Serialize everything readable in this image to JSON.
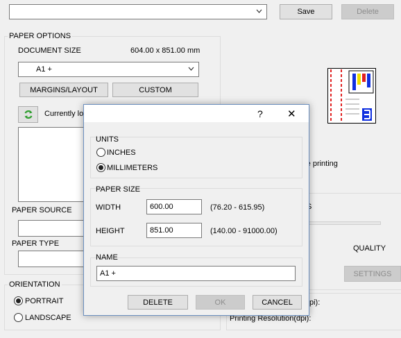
{
  "toolbar": {
    "preset_value": "",
    "save_label": "Save",
    "delete_label": "Delete"
  },
  "paper_options": {
    "legend": "PAPER OPTIONS",
    "document_size_label": "DOCUMENT SIZE",
    "document_size_value": "604.00 x 851.00 mm",
    "size_selected": "A1 +",
    "margins_button": "MARGINS/LAYOUT",
    "custom_button": "CUSTOM",
    "currently_text": "Currently lo",
    "paper_source_label": "PAPER SOURCE",
    "paper_type_label": "PAPER TYPE"
  },
  "orientation": {
    "legend": "ORIENTATION",
    "portrait_label": "PORTRAIT",
    "landscape_label": "LANDSCAPE",
    "selected": "portrait"
  },
  "right_panel": {
    "printing_text": "re printing",
    "s_fragment": "S",
    "quality_label": "QUALITY",
    "settings_button": "SETTINGS",
    "dpi_fragment": "pi):",
    "printing_resolution_label": "Printing Resolution(dpi):"
  },
  "dialog": {
    "help_glyph": "?",
    "close_glyph": "✕",
    "units_legend": "UNITS",
    "inches_label": "INCHES",
    "millimeters_label": "MILLIMETERS",
    "selected_unit": "millimeters",
    "paper_size_legend": "PAPER SIZE",
    "width_label": "WIDTH",
    "width_value": "600.00",
    "width_range": "(76.20 - 615.95)",
    "height_label": "HEIGHT",
    "height_value": "851.00",
    "height_range": "(140.00 - 91000.00)",
    "name_legend": "NAME",
    "name_value": "A1 +",
    "delete_button": "DELETE",
    "ok_button": "OK",
    "cancel_button": "CANCEL"
  },
  "colors": {
    "dialog_border": "#6b8fbf",
    "refresh_icon": "#2e9e2e",
    "preview_red": "#e02020",
    "preview_blue": "#1030e0",
    "preview_yellow": "#f0e000"
  }
}
